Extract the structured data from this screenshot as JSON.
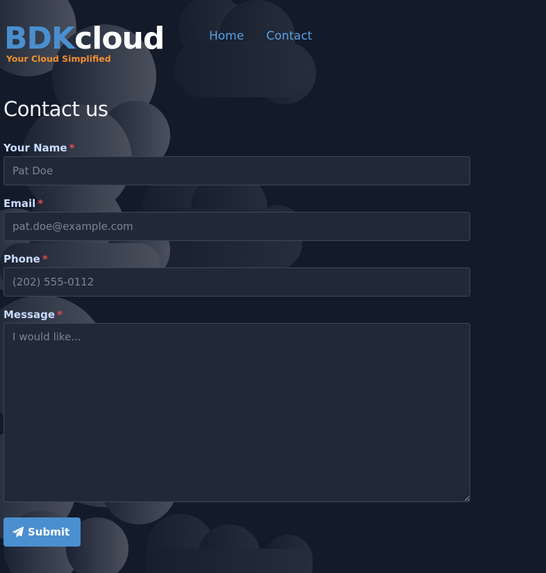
{
  "brand": {
    "name_part1": "BDK",
    "name_part2": "cloud",
    "tagline": "Your Cloud Simplified",
    "accent_color": "#4a8fd0",
    "tagline_color": "#f0902c"
  },
  "nav": {
    "items": [
      {
        "label": "Home"
      },
      {
        "label": "Contact"
      }
    ]
  },
  "page": {
    "title": "Contact us"
  },
  "form": {
    "required_marker": "*",
    "name": {
      "label": "Your Name",
      "placeholder": "Pat Doe",
      "value": ""
    },
    "email": {
      "label": "Email",
      "placeholder": "pat.doe@example.com",
      "value": ""
    },
    "phone": {
      "label": "Phone",
      "placeholder": "(202) 555-0112",
      "value": ""
    },
    "message": {
      "label": "Message",
      "placeholder": "I would like...",
      "value": ""
    },
    "submit": {
      "label": "Submit",
      "icon": "paper-plane-icon"
    }
  },
  "colors": {
    "background": "#131a2a",
    "field_background": "#202938",
    "required": "#e24a4a"
  }
}
